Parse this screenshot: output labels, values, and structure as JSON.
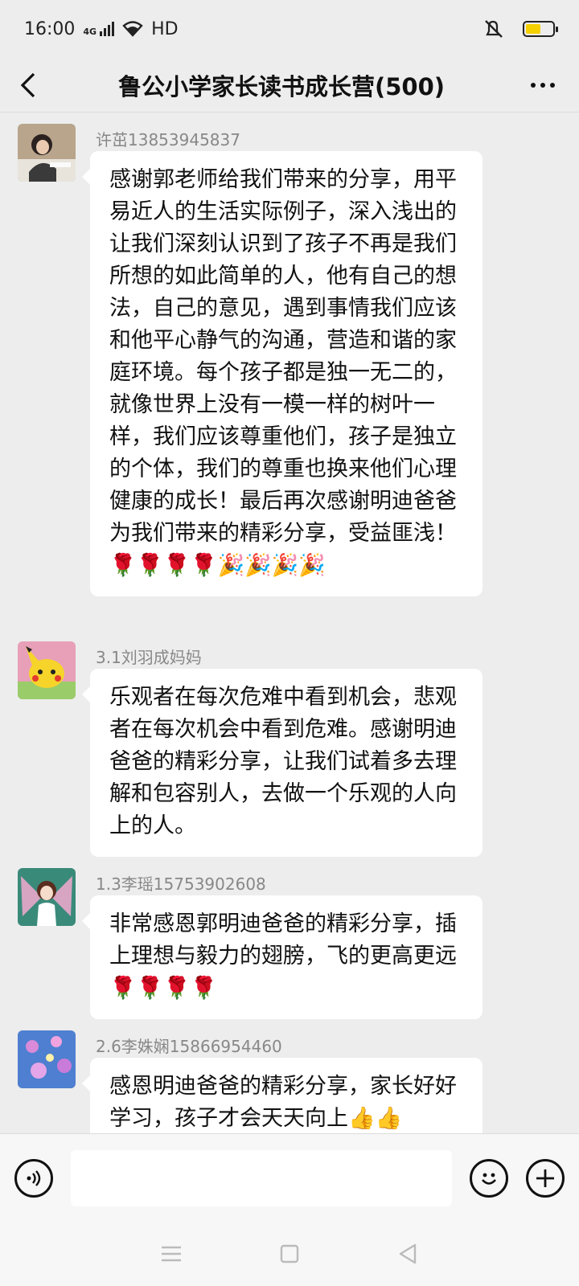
{
  "status": {
    "time": "16:00",
    "network": "4G",
    "hd": "HD"
  },
  "header": {
    "title": "鲁公小学家长读书成长营(500)"
  },
  "messages": [
    {
      "sender": "许茁13853945837",
      "text": "感谢郭老师给我们带来的分享，用平易近人的生活实际例子，深入浅出的让我们深刻认识到了孩子不再是我们所想的如此简单的人，他有自己的想法，自己的意见，遇到事情我们应该和他平心静气的沟通，营造和谐的家庭环境。每个孩子都是独一无二的，就像世界上没有一模一样的树叶一样，我们应该尊重他们，孩子是独立的个体，我们的尊重也换来他们心理健康的成长！最后再次感谢明迪爸爸为我们带来的精彩分享，受益匪浅！🌹🌹🌹🌹🎉🎉🎉🎉"
    },
    {
      "sender": "3.1刘羽成妈妈",
      "text": "乐观者在每次危难中看到机会，悲观者在每次机会中看到危难。感谢明迪爸爸的精彩分享，让我们试着多去理解和包容别人，去做一个乐观的人向上的人。"
    },
    {
      "sender": "1.3李瑶15753902608",
      "text": "非常感恩郭明迪爸爸的精彩分享，插上理想与毅力的翅膀，飞的更高更远🌹🌹🌹🌹"
    },
    {
      "sender": "2.6李姝娴15866954460",
      "text": "感恩明迪爸爸的精彩分享，家长好好学习，孩子才会天天向上👍👍"
    }
  ],
  "input": {
    "value": ""
  },
  "colors": {
    "background": "#ededed",
    "bubble": "#ffffff",
    "battery": "#f5d000"
  },
  "icons": [
    "back-arrow-icon",
    "more-icon",
    "voice-icon",
    "emoji-icon",
    "plus-icon",
    "menu-icon",
    "home-icon",
    "back-nav-icon",
    "mute-icon",
    "wifi-icon",
    "battery-icon"
  ]
}
